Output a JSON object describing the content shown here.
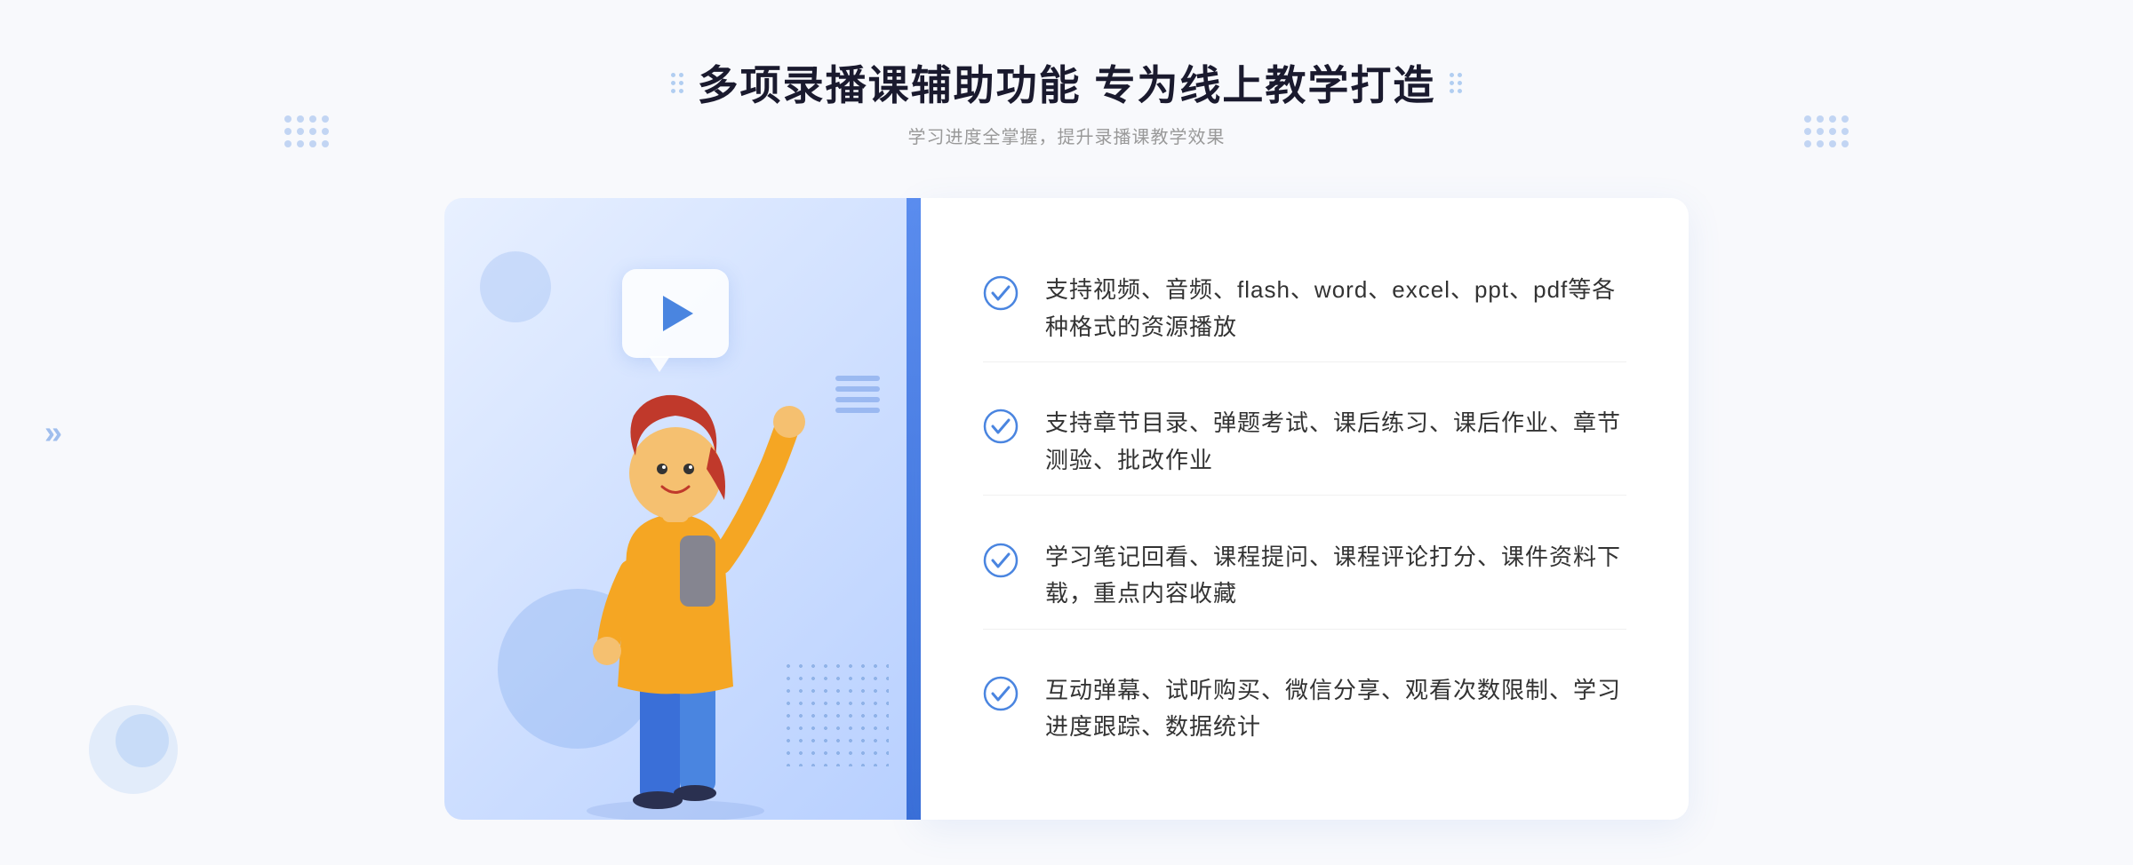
{
  "header": {
    "title": "多项录播课辅助功能 专为线上教学打造",
    "subtitle": "学习进度全掌握，提升录播课教学效果"
  },
  "features": [
    {
      "id": "feature-1",
      "text": "支持视频、音频、flash、word、excel、ppt、pdf等各种格式的资源播放"
    },
    {
      "id": "feature-2",
      "text": "支持章节目录、弹题考试、课后练习、课后作业、章节测验、批改作业"
    },
    {
      "id": "feature-3",
      "text": "学习笔记回看、课程提问、课程评论打分、课件资料下载，重点内容收藏"
    },
    {
      "id": "feature-4",
      "text": "互动弹幕、试听购买、微信分享、观看次数限制、学习进度跟踪、数据统计"
    }
  ],
  "colors": {
    "accent_blue": "#4a85e0",
    "dark_blue": "#3a6fd8",
    "title_color": "#1a1a2e",
    "text_color": "#333333",
    "subtitle_color": "#999999"
  },
  "icons": {
    "check_circle": "check-circle-icon",
    "play": "play-icon",
    "chevron": "chevron-right-icon"
  }
}
